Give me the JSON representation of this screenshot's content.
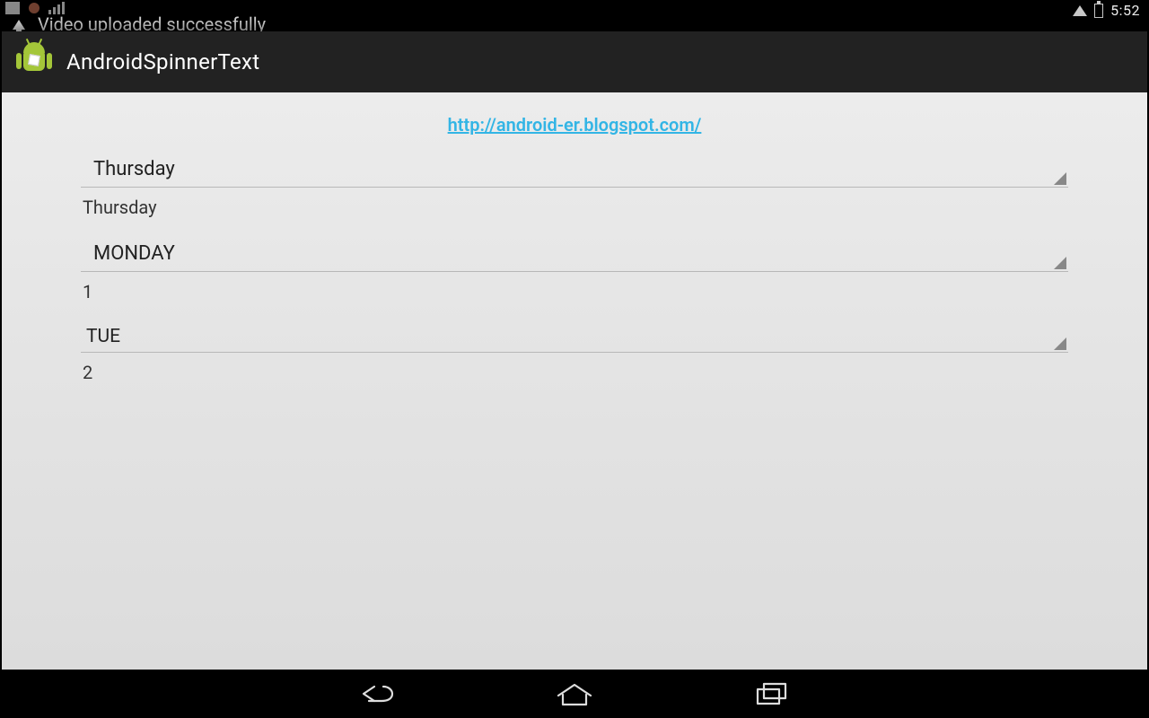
{
  "statusbar": {
    "clock": "5:52",
    "notification_text": "Video uploaded successfully"
  },
  "actionbar": {
    "title": "AndroidSpinnerText"
  },
  "content": {
    "link_text": "http://android-er.blogspot.com/",
    "spinner1": {
      "selected": "Thursday"
    },
    "result1": "Thursday",
    "spinner2": {
      "selected": "MONDAY"
    },
    "result2": "1",
    "spinner3": {
      "selected": "TUE"
    },
    "result3": "2"
  }
}
